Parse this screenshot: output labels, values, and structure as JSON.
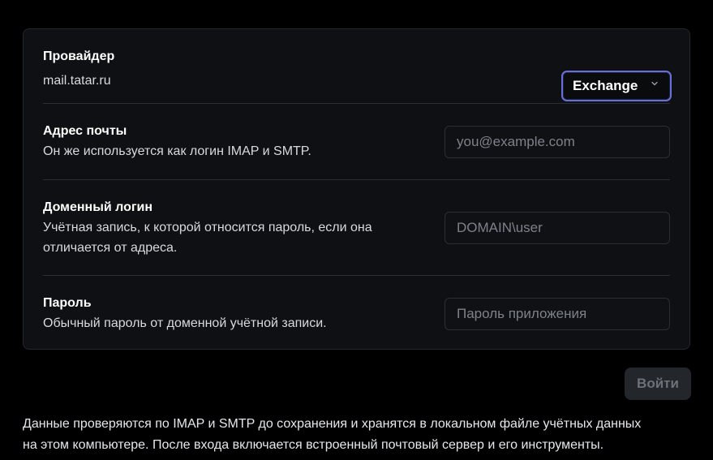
{
  "provider": {
    "title": "Провайдер",
    "value": "mail.tatar.ru",
    "selected": "Exchange",
    "chevron_icon": "chevron-down-icon"
  },
  "email": {
    "title": "Адрес почты",
    "description": "Он же используется как логин IMAP и SMTP.",
    "placeholder": "you@example.com",
    "value": ""
  },
  "domain_login": {
    "title": "Доменный логин",
    "description_line1": "Учётная запись, к которой относится пароль, если она",
    "description_line2": "отличается от адреса.",
    "placeholder": "DOMAIN\\user",
    "value": ""
  },
  "password": {
    "title": "Пароль",
    "description": "Обычный пароль от доменной учётной записи.",
    "placeholder": "Пароль приложения",
    "value": ""
  },
  "actions": {
    "login_label": "Войти"
  },
  "footer": {
    "line1": "Данные проверяются по IMAP и SMTP до сохранения и хранятся в локальном файле учётных данных",
    "line2": "на этом компьютере. После входа включается встроенный почтовый сервер и его инструменты."
  },
  "colors": {
    "accent_ring": "#6870d8",
    "card_bg": "#0e1013",
    "page_bg": "#000000",
    "button_disabled_bg": "#23262b"
  }
}
